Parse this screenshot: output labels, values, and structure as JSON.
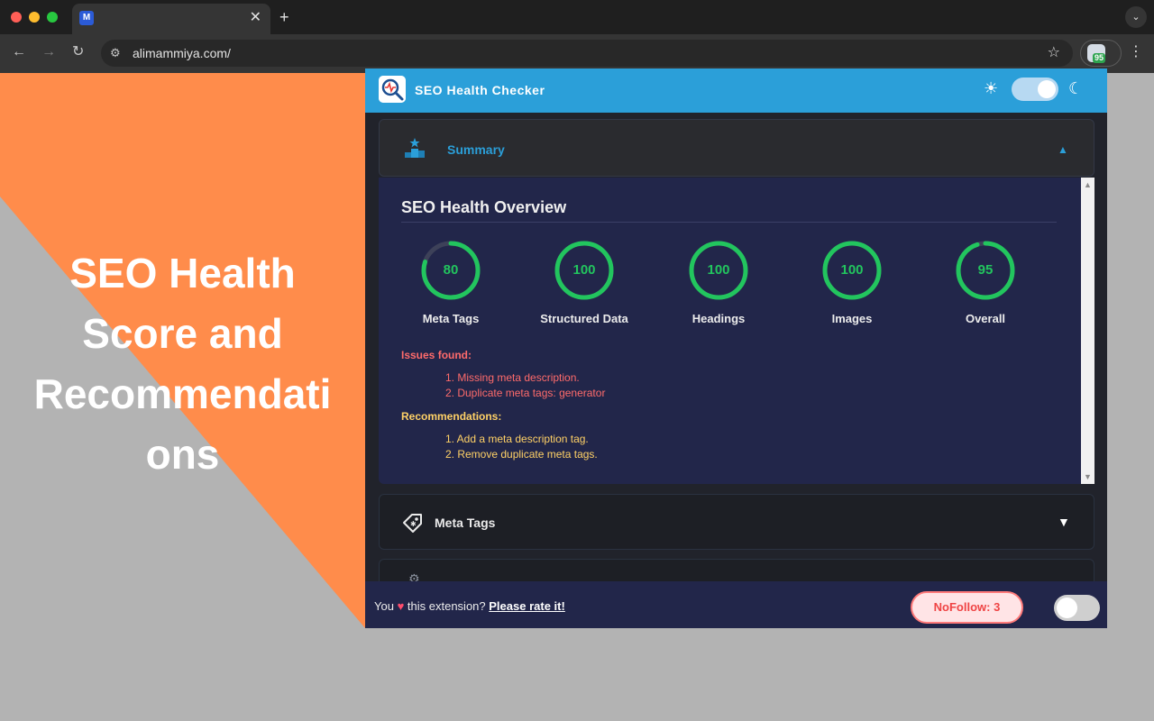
{
  "browser": {
    "tab": {
      "favicon_letter": "M",
      "close_glyph": "✕"
    },
    "new_tab_glyph": "+",
    "tab_menu_glyph": "⌄",
    "nav": {
      "back": "←",
      "forward": "→",
      "reload": "↻"
    },
    "site_info_glyph": "⚙",
    "url": "alimammiya.com/",
    "bookmark_glyph": "☆",
    "extension_badge": "95",
    "menu_glyph": "⋮"
  },
  "promo": {
    "lines": [
      "SEO Health",
      "Score and",
      "Recommendati",
      "ons"
    ]
  },
  "colors": {
    "orange": "#ff8c4b",
    "gray": "#b3b3b3",
    "header_blue": "#2b9fd9",
    "score_green": "#22c55e",
    "issue_red": "#ff6b6b",
    "rec_yellow": "#ffd166"
  },
  "popup": {
    "header": {
      "title": "SEO Health Checker",
      "logo_icon": "seo-health-logo-icon",
      "sun_glyph": "☀",
      "moon_glyph": "☾"
    },
    "summary": {
      "label": "Summary",
      "icon": "podium-icon",
      "caret": "▲",
      "title": "SEO Health Overview",
      "scores": [
        {
          "label": "Meta Tags",
          "value": "80",
          "percent": 80
        },
        {
          "label": "Structured Data",
          "value": "100",
          "percent": 100
        },
        {
          "label": "Headings",
          "value": "100",
          "percent": 100
        },
        {
          "label": "Images",
          "value": "100",
          "percent": 100
        },
        {
          "label": "Overall",
          "value": "95",
          "percent": 95
        }
      ],
      "issues_heading": "Issues found:",
      "issues": [
        "1. Missing meta description.",
        "2. Duplicate meta tags: generator"
      ],
      "recommendations_heading": "Recommendations:",
      "recommendations": [
        "1. Add a meta description tag.",
        "2. Remove duplicate meta tags."
      ],
      "scroll_up": "▲",
      "scroll_down": "▼"
    },
    "meta_tags": {
      "label": "Meta Tags",
      "icon": "tag-icon",
      "caret": "▼"
    },
    "next_section": {
      "icon": "gear-icon",
      "glyph": "⚙"
    },
    "footer": {
      "rate_prefix": "You",
      "heart": "♥",
      "rate_middle": "this extension?",
      "rate_link": "Please rate it!",
      "nofollow": "NoFollow: 3"
    }
  }
}
